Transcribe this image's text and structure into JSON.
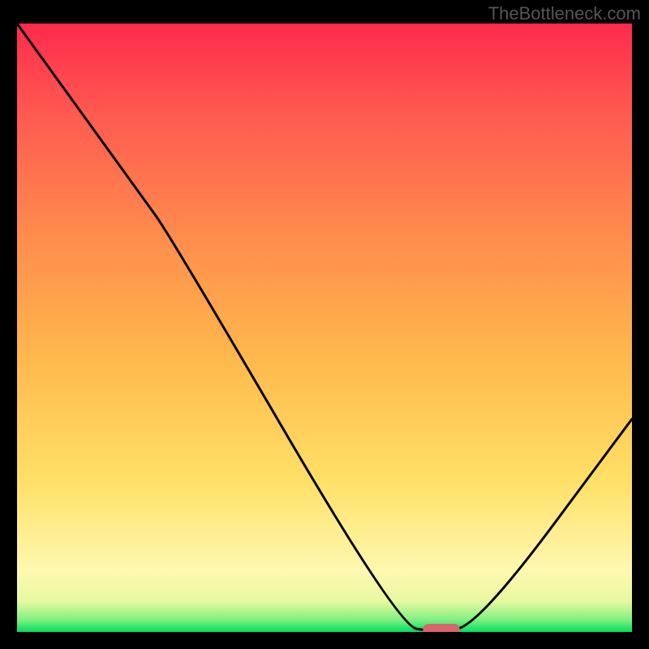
{
  "watermark": "TheBottleneck.com",
  "chart_data": {
    "type": "line",
    "title": "",
    "xlabel": "",
    "ylabel": "",
    "xlim": [
      0,
      100
    ],
    "ylim": [
      0,
      100
    ],
    "gradient_stops": [
      {
        "offset": 0,
        "color": "#00e060"
      },
      {
        "offset": 2,
        "color": "#80f080"
      },
      {
        "offset": 5,
        "color": "#e8f8a0"
      },
      {
        "offset": 10,
        "color": "#fff8b0"
      },
      {
        "offset": 25,
        "color": "#ffe066"
      },
      {
        "offset": 45,
        "color": "#ffb84d"
      },
      {
        "offset": 65,
        "color": "#ff8c4d"
      },
      {
        "offset": 85,
        "color": "#ff5a50"
      },
      {
        "offset": 100,
        "color": "#ff2a4d"
      }
    ],
    "curve": [
      {
        "x": 0,
        "y": 100
      },
      {
        "x": 20,
        "y": 72
      },
      {
        "x": 25,
        "y": 65
      },
      {
        "x": 62,
        "y": 1
      },
      {
        "x": 68,
        "y": 0
      },
      {
        "x": 75,
        "y": 1
      },
      {
        "x": 100,
        "y": 35
      }
    ],
    "marker": {
      "x_center": 69,
      "y": 0,
      "width": 6,
      "color": "#d9636e"
    }
  }
}
